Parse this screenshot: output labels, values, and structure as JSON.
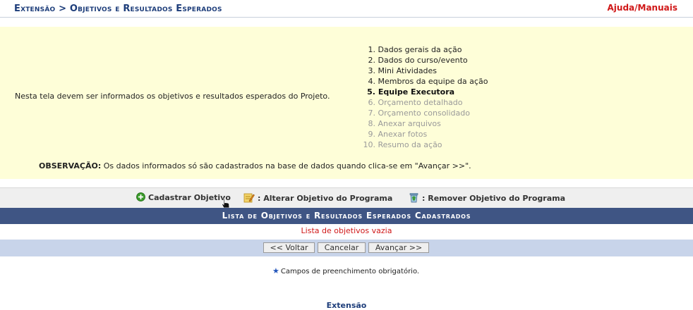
{
  "header": {
    "title": "Extensão > Objetivos e Resultados Esperados",
    "help_link": "Ajuda/Manuais"
  },
  "info": {
    "description": "Nesta tela devem ser informados os objetivos e resultados esperados do Projeto.",
    "steps": [
      {
        "num": "1.",
        "label": "Dados gerais da ação",
        "state": "done"
      },
      {
        "num": "2.",
        "label": "Dados do curso/evento",
        "state": "done"
      },
      {
        "num": "3.",
        "label": "Mini Atividades",
        "state": "done"
      },
      {
        "num": "4.",
        "label": "Membros da equipe da ação",
        "state": "done"
      },
      {
        "num": "5.",
        "label": "Equipe Executora",
        "state": "current"
      },
      {
        "num": "6.",
        "label": "Orçamento detalhado",
        "state": "todo"
      },
      {
        "num": "7.",
        "label": "Orçamento consolidado",
        "state": "todo"
      },
      {
        "num": "8.",
        "label": "Anexar arquivos",
        "state": "todo"
      },
      {
        "num": "9.",
        "label": "Anexar fotos",
        "state": "todo"
      },
      {
        "num": "10.",
        "label": "Resumo da ação",
        "state": "todo"
      }
    ],
    "observation_label": "OBSERVAÇÃO:",
    "observation_text": " Os dados informados só são cadastrados na base de dados quando clica-se em \"Avançar >>\"."
  },
  "legend": {
    "add_label": "Cadastrar Objetivo",
    "edit_label": ": Alterar Objetivo do Programa",
    "remove_label": ": Remover Objetivo do Programa"
  },
  "list": {
    "header": "Lista de Objetivos e Resultados Esperados Cadastrados",
    "empty_message": "Lista de objetivos vazia"
  },
  "buttons": {
    "back": "<< Voltar",
    "cancel": "Cancelar",
    "next": "Avançar >>"
  },
  "required_note": "Campos de preenchimento obrigatório.",
  "footer_link": "Extensão",
  "colors": {
    "title": "#1d3d7a",
    "help": "#d01818",
    "info_bg": "#fefed8",
    "list_header_bg": "#3f5584",
    "button_row_bg": "#c8d4ea"
  }
}
